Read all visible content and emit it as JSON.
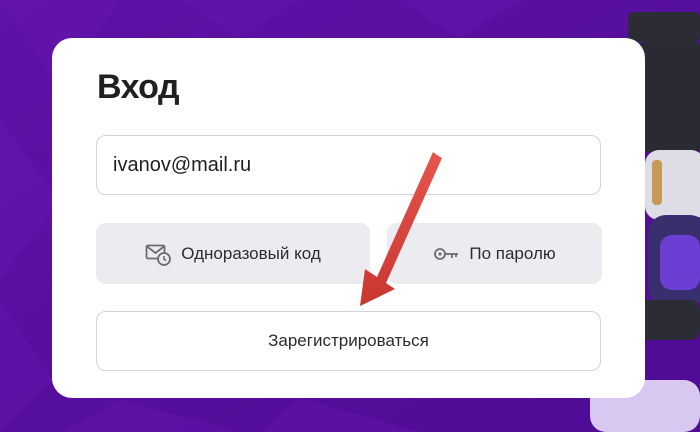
{
  "login": {
    "title": "Вход",
    "email_value": "ivanov@mail.ru",
    "otp_button_label": "Одноразовый код",
    "password_button_label": "По паролю",
    "register_button_label": "Зарегистрироваться"
  },
  "icons": {
    "otp": "mail-clock-icon",
    "password": "key-icon"
  },
  "colors": {
    "background": "#5a0fa0",
    "card": "#ffffff",
    "button_gray": "#ececf0",
    "arrow": "#e0473f"
  }
}
